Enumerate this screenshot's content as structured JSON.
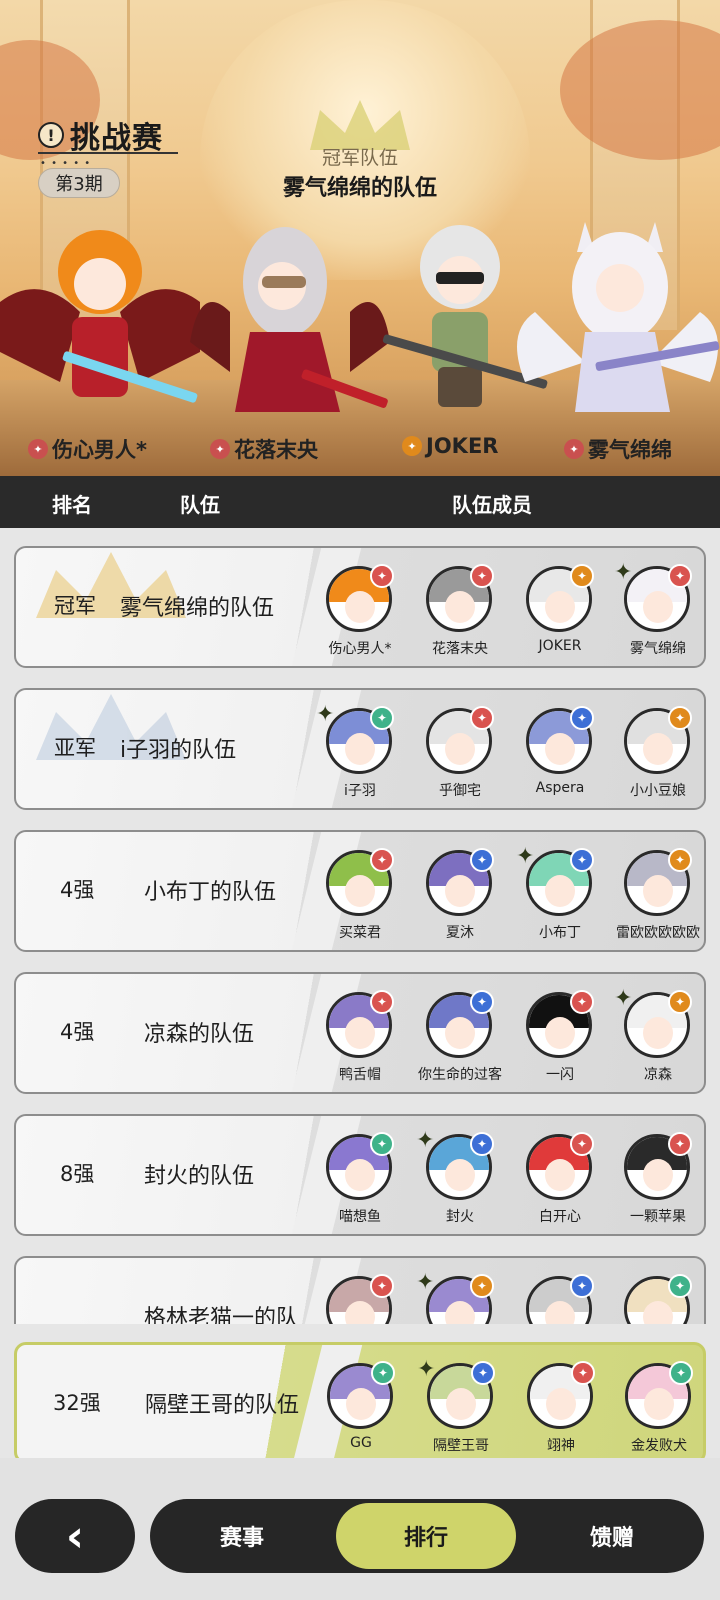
{
  "hero": {
    "title": "挑战赛",
    "title_icon": "!",
    "period": "第3期",
    "champion_label": "冠军队伍",
    "champion_team": "雾气绵绵的队伍",
    "characters": [
      {
        "name": "伤心男人*",
        "class_color": "#c9504f",
        "hair": "#f08a1a"
      },
      {
        "name": "花落末央",
        "class_color": "#c9504f",
        "hair": "#d8d4d8"
      },
      {
        "name": "JOKER",
        "class_color": "#e08a1c",
        "hair": "#e6e6e6"
      },
      {
        "name": "雾气绵绵",
        "class_color": "#c9504f",
        "hair": "#f0eef4"
      }
    ]
  },
  "header": {
    "rank": "排名",
    "team": "队伍",
    "members": "队伍成员"
  },
  "rows": [
    {
      "rank": "冠军",
      "team": "雾气绵绵的队伍",
      "members": [
        {
          "name": "伤心男人*",
          "badge": "#d9534f",
          "hair": "#f08a1a",
          "star": false
        },
        {
          "name": "花落末央",
          "badge": "#d9534f",
          "hair": "#9a9a9a",
          "star": false
        },
        {
          "name": "JOKER",
          "badge": "#e08a1c",
          "hair": "#e8e8e8",
          "star": false
        },
        {
          "name": "雾气绵绵",
          "badge": "#d9534f",
          "hair": "#f3f1f6",
          "star": true
        }
      ]
    },
    {
      "rank": "亚军",
      "team": "i子羽的队伍",
      "members": [
        {
          "name": "i子羽",
          "badge": "#3fb28a",
          "hair": "#7d8ed6",
          "star": true
        },
        {
          "name": "乎御宅",
          "badge": "#d9534f",
          "hair": "#e4e4e4",
          "star": false
        },
        {
          "name": "Aspera",
          "badge": "#3d6fd6",
          "hair": "#8c9ad8",
          "star": false
        },
        {
          "name": "小小豆娘",
          "badge": "#e08a1c",
          "hair": "#e0e0e0",
          "star": false
        }
      ]
    },
    {
      "rank": "4强",
      "team": "小布丁的队伍",
      "members": [
        {
          "name": "买菜君",
          "badge": "#d9534f",
          "hair": "#8fbf4a",
          "star": false
        },
        {
          "name": "夏沐",
          "badge": "#3d6fd6",
          "hair": "#7d6fc0",
          "star": false
        },
        {
          "name": "小布丁",
          "badge": "#3d6fd6",
          "hair": "#7fd6b6",
          "star": true
        },
        {
          "name": "雷欧欧欧欧欧",
          "badge": "#e08a1c",
          "hair": "#b8b8c8",
          "star": false
        }
      ]
    },
    {
      "rank": "4强",
      "team": "凉森的队伍",
      "members": [
        {
          "name": "鸭舌帽",
          "badge": "#d9534f",
          "hair": "#8a7ac8",
          "star": false
        },
        {
          "name": "你生命的过客",
          "badge": "#3d6fd6",
          "hair": "#6f78c8",
          "star": false
        },
        {
          "name": "一闪",
          "badge": "#d9534f",
          "hair": "#111111",
          "star": false
        },
        {
          "name": "凉森",
          "badge": "#e08a1c",
          "hair": "#f0f0f0",
          "star": true
        }
      ]
    },
    {
      "rank": "8强",
      "team": "封火的队伍",
      "members": [
        {
          "name": "喵想鱼",
          "badge": "#3fb28a",
          "hair": "#8a78d0",
          "star": false
        },
        {
          "name": "封火",
          "badge": "#3d6fd6",
          "hair": "#5aa6d8",
          "star": true
        },
        {
          "name": "白开心",
          "badge": "#d9534f",
          "hair": "#e03a3a",
          "star": false
        },
        {
          "name": "一颗苹果",
          "badge": "#d9534f",
          "hair": "#2a2a2a",
          "star": false
        }
      ]
    },
    {
      "rank": "",
      "team": "格林老猫一的队",
      "members": [
        {
          "name": "",
          "badge": "#d9534f",
          "hair": "#c8a8a8",
          "star": false
        },
        {
          "name": "",
          "badge": "#e08a1c",
          "hair": "#9a8ad0",
          "star": true
        },
        {
          "name": "",
          "badge": "#3d6fd6",
          "hair": "#cccccc",
          "star": false
        },
        {
          "name": "",
          "badge": "#3fb28a",
          "hair": "#f0e0c0",
          "star": false
        }
      ]
    }
  ],
  "my_row": {
    "rank": "32强",
    "team": "隔壁王哥的队伍",
    "members": [
      {
        "name": "GG",
        "badge": "#3fb28a",
        "hair": "#9a8ad0",
        "star": false
      },
      {
        "name": "隔壁王哥",
        "badge": "#3d6fd6",
        "hair": "#c8d89a",
        "star": true
      },
      {
        "name": "翊神",
        "badge": "#d9534f",
        "hair": "#f0f0f0",
        "star": false
      },
      {
        "name": "金发败犬",
        "badge": "#3fb28a",
        "hair": "#f4c8d8",
        "star": false
      }
    ]
  },
  "nav": {
    "back_icon": "‹",
    "tabs": [
      "赛事",
      "排行",
      "馈赠"
    ],
    "active_tab": "排行"
  },
  "colors": {
    "accent": "#cfd46a",
    "dark": "#262626"
  }
}
